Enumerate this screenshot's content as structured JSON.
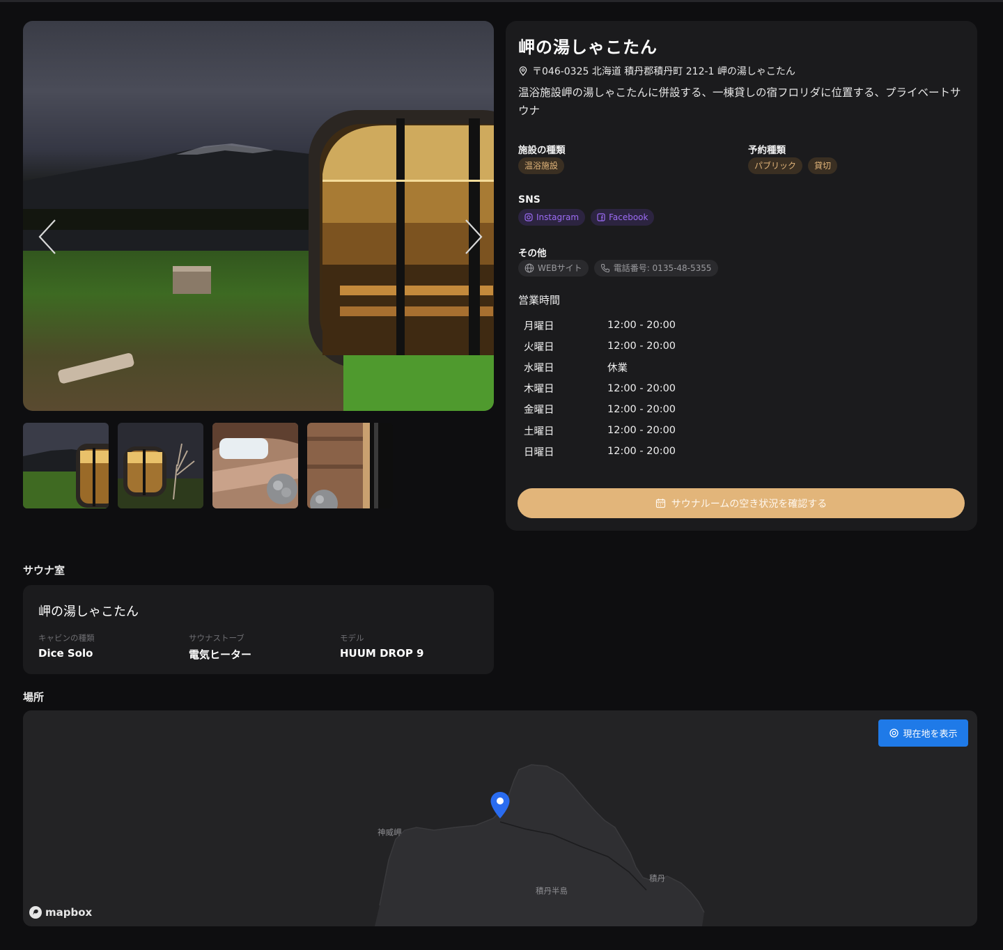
{
  "facility": {
    "name": "岬の湯しゃこたん",
    "address": "〒046-0325 北海道 積丹郡積丹町 212-1 岬の湯しゃこたん",
    "description": "温浴施設岬の湯しゃこたんに併設する、一棟貸しの宿フロリダに位置する、プライベートサウナ"
  },
  "facility_type": {
    "label": "施設の種類",
    "tags": [
      "温浴施設"
    ]
  },
  "reservation_type": {
    "label": "予約種類",
    "tags": [
      "パブリック",
      "貸切"
    ]
  },
  "sns": {
    "label": "SNS",
    "instagram": "Instagram",
    "facebook": "Facebook"
  },
  "other": {
    "label": "その他",
    "website": "WEBサイト",
    "phone": "電話番号: 0135-48-5355"
  },
  "hours": {
    "title": "営業時間",
    "rows": [
      {
        "day": "月曜日",
        "time": "12:00 - 20:00"
      },
      {
        "day": "火曜日",
        "time": "12:00 - 20:00"
      },
      {
        "day": "水曜日",
        "time": "休業"
      },
      {
        "day": "木曜日",
        "time": "12:00 - 20:00"
      },
      {
        "day": "金曜日",
        "time": "12:00 - 20:00"
      },
      {
        "day": "土曜日",
        "time": "12:00 - 20:00"
      },
      {
        "day": "日曜日",
        "time": "12:00 - 20:00"
      }
    ]
  },
  "reserve_button": "サウナルームの空き状況を確認する",
  "sauna_section": {
    "title": "サウナ室",
    "room_name": "岬の湯しゃこたん",
    "specs": [
      {
        "label": "キャビンの種類",
        "value": "Dice Solo"
      },
      {
        "label": "サウナストーブ",
        "value": "電気ヒーター"
      },
      {
        "label": "モデル",
        "value": "HUUM DROP 9"
      }
    ]
  },
  "location_section": {
    "title": "場所",
    "locate_button": "現在地を表示",
    "places": [
      "神威岬",
      "積丹半島",
      "積丹"
    ],
    "attribution": "mapbox"
  },
  "colors": {
    "accent": "#e2b57a",
    "sns": "#9d6cf5",
    "map_button": "#1f7ae8",
    "pin": "#2a6cf0"
  },
  "icons": [
    "pin-outline-icon",
    "instagram-icon",
    "facebook-icon",
    "globe-icon",
    "phone-icon",
    "calendar-icon",
    "target-icon",
    "chevron-left-icon",
    "chevron-right-icon",
    "map-pin-icon",
    "mapbox-logo-icon"
  ]
}
